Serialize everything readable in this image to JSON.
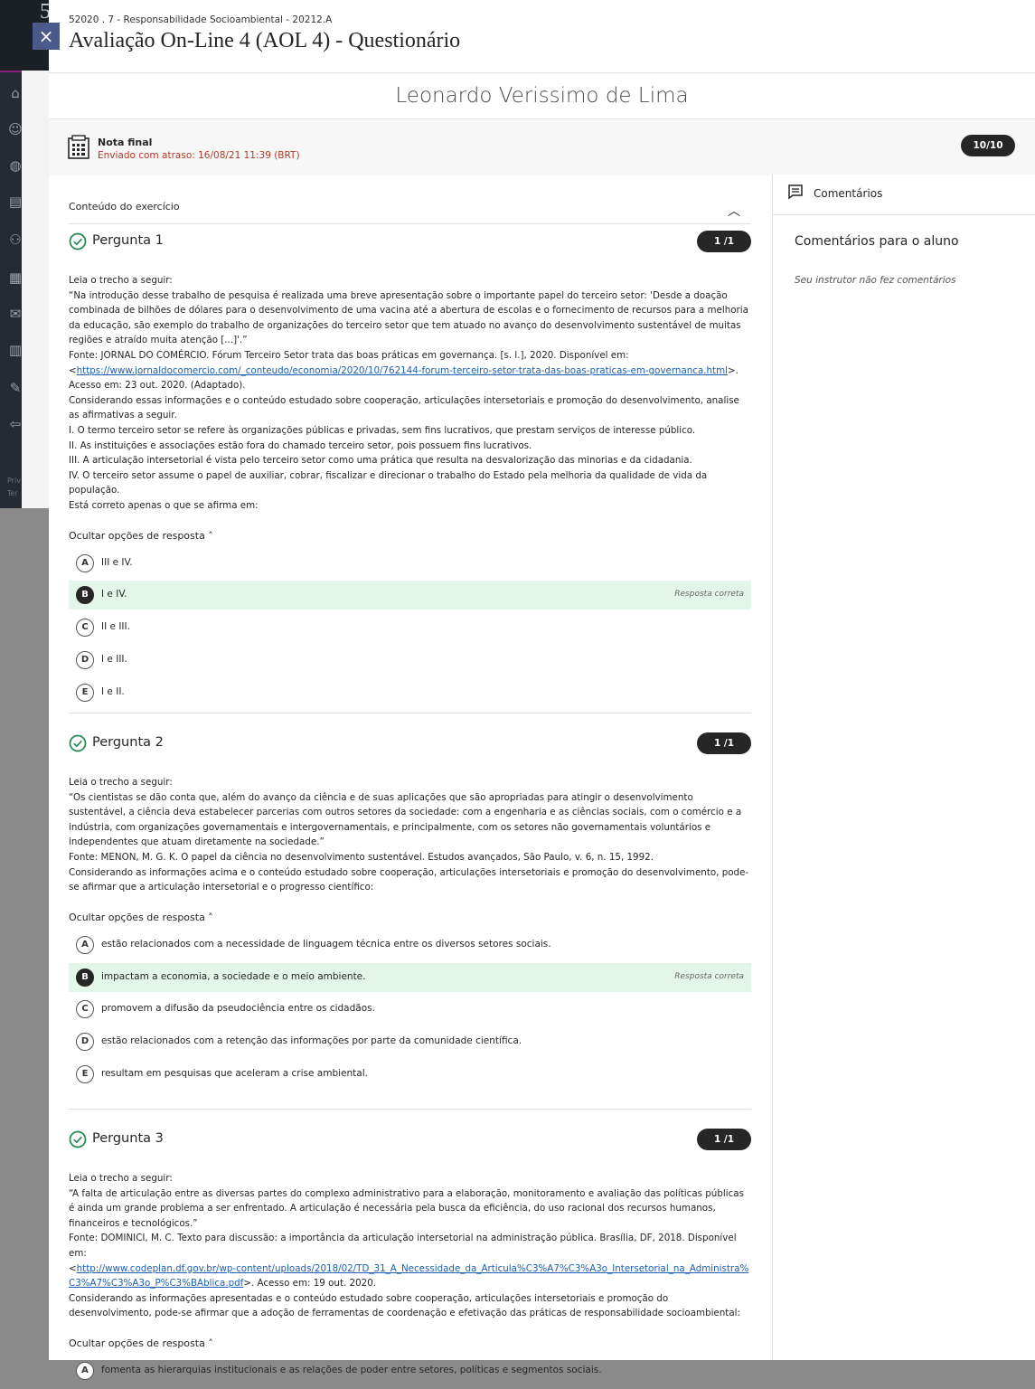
{
  "background": {
    "digit": "5",
    "privacy_lines": [
      "Priv",
      "Ter"
    ]
  },
  "header": {
    "breadcrumb": "52020 . 7 - Responsabilidade Socioambiental - 20212.A",
    "title": "Avaliação On-Line 4 (AOL 4) - Questionário",
    "close_label": "×"
  },
  "student_name": "Leonardo Verissimo de Lima",
  "grade": {
    "label": "Nota final",
    "submitted": "Enviado com atraso: 16/08/21 11:39 (BRT)",
    "score": "10/10"
  },
  "content": {
    "label": "Conteúdo do exercício",
    "toggle_label": "Ocultar opções de resposta",
    "correct_tag": "Resposta correta"
  },
  "comments": {
    "tab_label": "Comentários",
    "title": "Comentários para o aluno",
    "empty": "Seu instrutor não fez comentários"
  },
  "questions": [
    {
      "title": "Pergunta 1",
      "score": "1 /1",
      "lines": [
        "Leia o trecho a seguir:",
        "“Na introdução desse trabalho de pesquisa é realizada uma breve apresentação sobre o importante papel do terceiro setor: 'Desde a doação combinada de bilhões de dólares para o desenvolvimento de uma vacina até a abertura de escolas e o fornecimento de recursos para a melhoria da educação, são exemplo do trabalho de organizações do terceiro setor que tem atuado no avanço do desenvolvimento sustentável de muitas regiões e atraído muita atenção [...]'.”",
        "Fonte: JORNAL DO COMÉRCIO. Fórum Terceiro Setor trata das boas práticas em governança. [s. l.], 2020. Disponível em:",
        "Considerando essas informações e o conteúdo estudado sobre cooperação, articulações intersetoriais e promoção do desenvolvimento, analise as afirmativas a seguir.",
        "I. O termo terceiro setor se refere às organizações públicas e privadas, sem fins lucrativos, que prestam serviços de interesse público.",
        "II. As instituições e associações estão fora do chamado terceiro setor, pois possuem fins lucrativos.",
        "III. A articulação intersetorial é vista pelo terceiro setor como uma prática que resulta na desvalorização das minorias e da cidadania.",
        "IV. O terceiro setor assume o papel de auxiliar, cobrar, fiscalizar e direcionar o trabalho do Estado pela melhoria da qualidade de vida da população.",
        "Está correto apenas o que se afirma em:"
      ],
      "link_prefix": "<",
      "link": "https://www.jornaldocomercio.com/_conteudo/economia/2020/10/762144-forum-terceiro-setor-trata-das-boas-praticas-em-governanca.html",
      "link_suffix": ">. Acesso em: 23 out. 2020. (Adaptado).",
      "options": [
        {
          "letter": "A",
          "text": "III e IV."
        },
        {
          "letter": "B",
          "text": "I e IV."
        },
        {
          "letter": "C",
          "text": "II e III."
        },
        {
          "letter": "D",
          "text": "I e III."
        },
        {
          "letter": "E",
          "text": "I e II."
        }
      ]
    },
    {
      "title": "Pergunta 2",
      "score": "1 /1",
      "lines": [
        "Leia o trecho a seguir:",
        "“Os cientistas se dão conta que, além do avanço da ciência e de suas aplicações que são apropriadas para atingir o desenvolvimento sustentável, a ciência deva estabelecer parcerias com outros setores da sociedade: com a engenharia e as ciências sociais, com o comércio e a indústria, com organizações governamentais e intergovernamentais, e principalmente, com os setores não governamentais voluntários e independentes que atuam diretamente na sociedade.”",
        "Fonte: MENON, M. G. K. O papel da ciência no desenvolvimento sustentável. Estudos avançados, São Paulo, v. 6, n. 15, 1992.",
        "Considerando as informações acima e o conteúdo estudado sobre cooperação, articulações intersetoriais e promoção do desenvolvimento, pode-se afirmar que a articulação intersetorial e o progresso científico:"
      ],
      "options": [
        {
          "letter": "A",
          "text": "estão relacionados com a necessidade de linguagem técnica entre os diversos setores sociais."
        },
        {
          "letter": "B",
          "text": "impactam a economia, a sociedade e o meio ambiente."
        },
        {
          "letter": "C",
          "text": "promovem a difusão da pseudociência entre os cidadãos."
        },
        {
          "letter": "D",
          "text": "estão relacionados com a retenção das informações por parte da comunidade científica."
        },
        {
          "letter": "E",
          "text": "resultam em pesquisas que aceleram a crise ambiental."
        }
      ]
    },
    {
      "title": "Pergunta 3",
      "score": "1 /1",
      "lines": [
        "Leia o trecho a seguir:",
        "“A falta de articulação entre as diversas partes do complexo administrativo para a elaboração, monitoramento e avaliação das políticas públicas é ainda um grande problema a ser enfrentado. A articulação é necessária pela busca da eficiência, do uso racional dos recursos humanos, financeiros e tecnológicos.”",
        "Fonte: DOMINICI, M. C. Texto para discussão: a importância da articulação intersetorial na administração pública. Brasília, DF, 2018. Disponível em:",
        "Considerando as informações apresentadas e o conteúdo estudado sobre cooperação, articulações intersetoriais e promoção do desenvolvimento, pode-se afirmar que a adoção de ferramentas de coordenação e efetivação das práticas de responsabilidade socioambiental:"
      ],
      "link_prefix": "<",
      "link": "http://www.codeplan.df.gov.br/wp-content/uploads/2018/02/TD_31_A_Necessidade_da_Articula%C3%A7%C3%A3o_Intersetorial_na_Administra%C3%A7%C3%A3o_P%C3%BAblica.pdf",
      "link_suffix": ">. Acesso em: 19 out. 2020.",
      "options": [
        {
          "letter": "A",
          "text": "fomenta as hierarquias institucionais e as relações de poder entre setores, políticas e segmentos sociais."
        }
      ]
    }
  ]
}
